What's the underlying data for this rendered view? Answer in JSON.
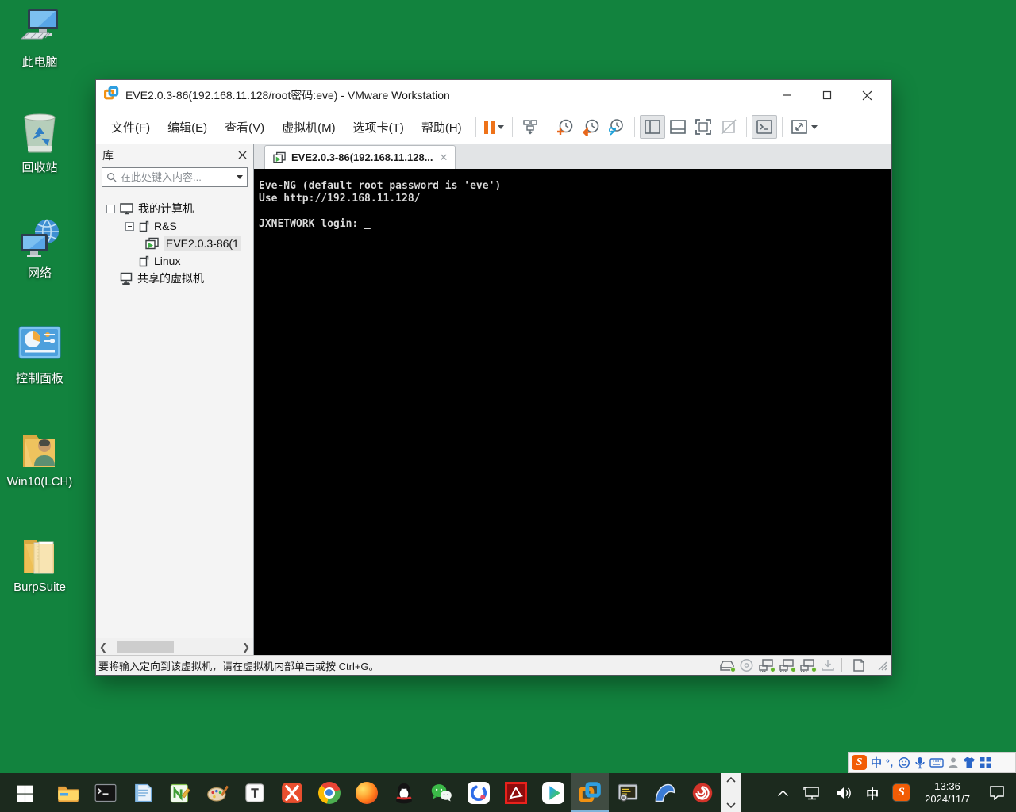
{
  "desktop": {
    "icons": [
      {
        "label": "此电脑"
      },
      {
        "label": "回收站"
      },
      {
        "label": "网络"
      },
      {
        "label": "控制面板"
      },
      {
        "label": "Win10(LCH)"
      },
      {
        "label": "BurpSuite"
      }
    ]
  },
  "window": {
    "title": "EVE2.0.3-86(192.168.11.128/root密码:eve) - VMware Workstation",
    "menus": [
      "文件(F)",
      "编辑(E)",
      "查看(V)",
      "虚拟机(M)",
      "选项卡(T)",
      "帮助(H)"
    ],
    "library": {
      "header": "库",
      "search_placeholder": "在此处键入内容...",
      "items": [
        {
          "label": "我的计算机"
        },
        {
          "label": "R&S"
        },
        {
          "label": "EVE2.0.3-86(1"
        },
        {
          "label": "Linux"
        },
        {
          "label": "共享的虚拟机"
        }
      ]
    },
    "tab_label": "EVE2.0.3-86(192.168.11.128...",
    "console_text": "Eve-NG (default root password is 'eve')\nUse http://192.168.11.128/\n\nJXNETWORK login: _",
    "status_message": "要将输入定向到该虚拟机，请在虚拟机内部单击或按 Ctrl+G。"
  },
  "taskbar": {
    "apps": [
      "start",
      "file-explorer",
      "command-prompt",
      "notepad",
      "notepad-plus-plus",
      "paint",
      "typora",
      "xmind",
      "chrome",
      "firefox",
      "qq",
      "wechat",
      "tencent-meeting",
      "acrobat-reader",
      "tencent-video",
      "vmware-workstation",
      "securecrt",
      "wireshark",
      "snail"
    ],
    "active_app": "vmware-workstation",
    "tray": {
      "ime_indicator": "中",
      "time": "13:36",
      "date": "2024/11/7"
    }
  },
  "sogou": {
    "ime_mode": "中",
    "punct": "°,"
  },
  "colors": {
    "desktop_green": "#12833e",
    "taskbar_dark": "#1c2a1e",
    "vmware_orange": "#ee7219",
    "vmware_blue": "#2e9fe0",
    "status_green_dot": "#63b32a",
    "active_underline": "#7fb3d9"
  }
}
